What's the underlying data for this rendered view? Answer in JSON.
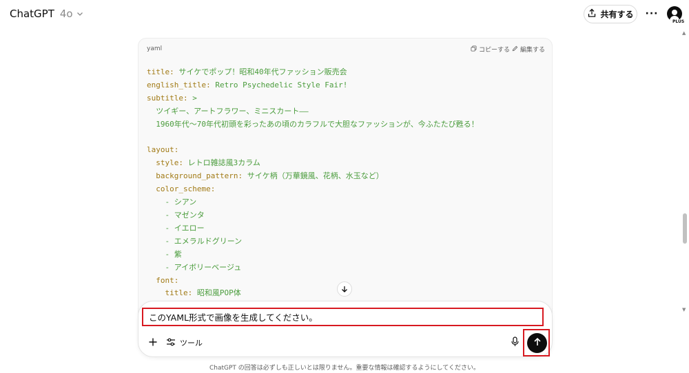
{
  "header": {
    "model_name": "ChatGPT",
    "model_version": "4o",
    "share_label": "共有する",
    "more_label": "···",
    "plan_badge": "PLUS"
  },
  "code_block": {
    "language": "yaml",
    "copy_label": "コピーする",
    "edit_label": "編集する",
    "lines": [
      [
        {
          "t": "title:",
          "c": "k"
        },
        {
          "t": " サイケでポップ！昭和40年代ファッション販売会",
          "c": "v"
        }
      ],
      [
        {
          "t": "english_title:",
          "c": "k"
        },
        {
          "t": " Retro Psychedelic Style Fair!",
          "c": "v"
        }
      ],
      [
        {
          "t": "subtitle:",
          "c": "k"
        },
        {
          "t": " >",
          "c": "v"
        }
      ],
      [
        {
          "t": "  ツイギー、アートフラワー、ミニスカート——",
          "c": "v"
        }
      ],
      [
        {
          "t": "  1960年代〜70年代初頭を彩ったあの頃のカラフルで大胆なファッションが、今ふたたび甦る！",
          "c": "v"
        }
      ],
      [],
      [
        {
          "t": "layout:",
          "c": "k"
        }
      ],
      [
        {
          "t": "  style:",
          "c": "k"
        },
        {
          "t": " レトロ雑誌風3カラム",
          "c": "v"
        }
      ],
      [
        {
          "t": "  background_pattern:",
          "c": "k"
        },
        {
          "t": " サイケ柄（万華鏡風、花柄、水玉など）",
          "c": "v"
        }
      ],
      [
        {
          "t": "  color_scheme:",
          "c": "k"
        }
      ],
      [
        {
          "t": "    - シアン",
          "c": "v"
        }
      ],
      [
        {
          "t": "    - マゼンタ",
          "c": "v"
        }
      ],
      [
        {
          "t": "    - イエロー",
          "c": "v"
        }
      ],
      [
        {
          "t": "    - エメラルドグリーン",
          "c": "v"
        }
      ],
      [
        {
          "t": "    - 紫",
          "c": "v"
        }
      ],
      [
        {
          "t": "    - アイボリーベージュ",
          "c": "v"
        }
      ],
      [
        {
          "t": "  font:",
          "c": "k"
        }
      ],
      [
        {
          "t": "    title:",
          "c": "k"
        },
        {
          "t": " 昭和風POP体",
          "c": "v"
        }
      ]
    ]
  },
  "composer": {
    "input_value": "このYAML形式で画像を生成してください。",
    "tools_label": "ツール"
  },
  "footer": {
    "disclaimer": "ChatGPT の回答は必ずしも正しいとは限りません。重要な情報は確認するようにしてください。"
  },
  "colors": {
    "yaml_key": "#a17a15",
    "yaml_value": "#4a9c3c",
    "highlight_outline": "#d71920"
  }
}
